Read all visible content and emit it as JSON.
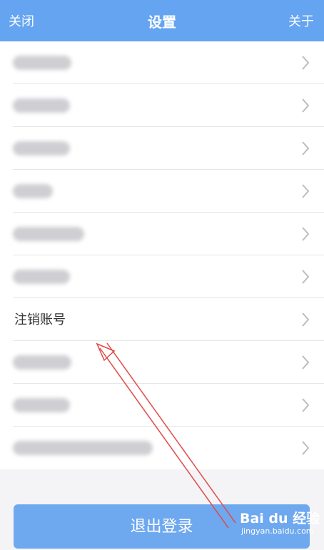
{
  "header": {
    "close_label": "关闭",
    "title": "设置",
    "about_label": "关于"
  },
  "list": {
    "items": [
      {
        "label": "",
        "visible": false
      },
      {
        "label": "",
        "visible": false
      },
      {
        "label": "",
        "visible": false
      },
      {
        "label": "",
        "visible": false
      },
      {
        "label": "",
        "visible": false
      },
      {
        "label": "",
        "visible": false
      },
      {
        "label": "注销账号",
        "visible": true
      },
      {
        "label": "",
        "visible": false
      },
      {
        "label": "",
        "visible": false
      },
      {
        "label": "",
        "visible": false
      }
    ]
  },
  "logout_label": "退出登录",
  "watermark": {
    "brand": "Bai du 经验",
    "site": "jingyan.baidu.com"
  },
  "colors": {
    "header": "#65a4f0",
    "button": "#6ea8ef",
    "annotation": "#e04848"
  }
}
